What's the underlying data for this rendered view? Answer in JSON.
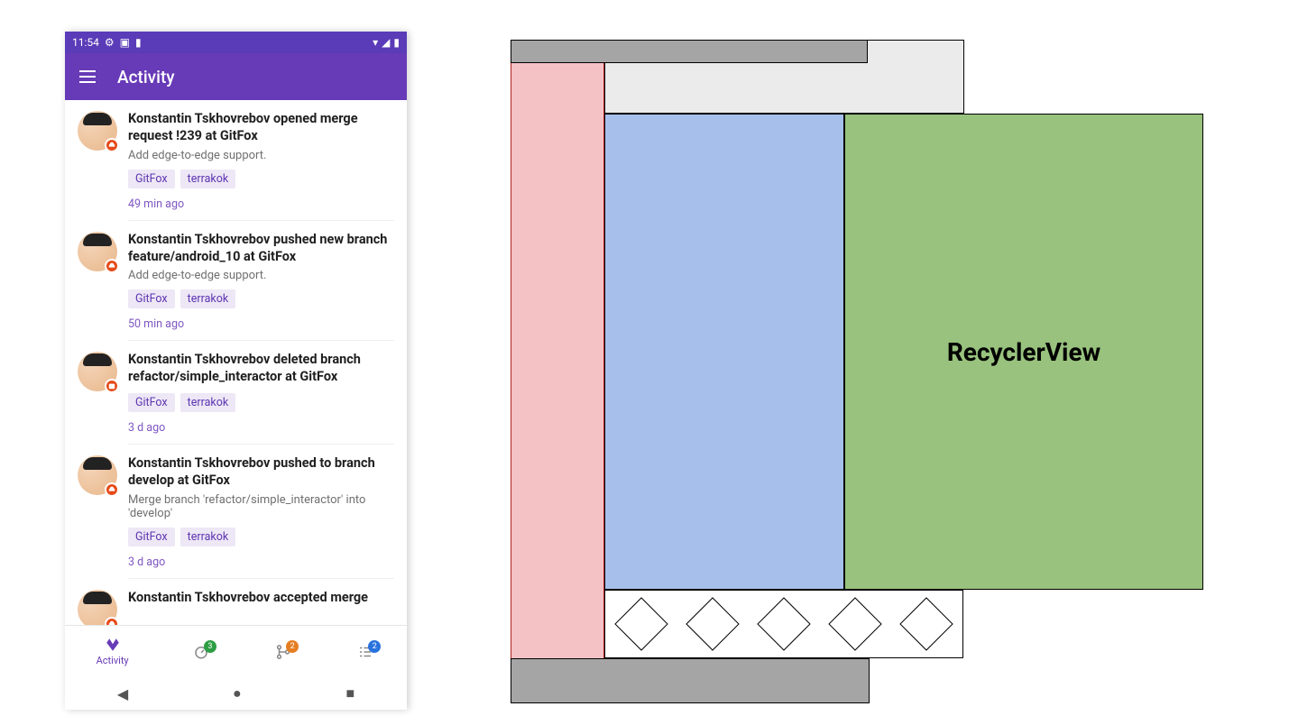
{
  "statusbar": {
    "time": "11:54",
    "icons_left": [
      "gear",
      "doc",
      "card"
    ],
    "icons_right": [
      "wifi",
      "signal",
      "battery"
    ]
  },
  "appbar": {
    "title": "Activity"
  },
  "feed": [
    {
      "title": "Konstantin Tskhovrebov opened merge request !239 at GitFox",
      "desc": "Add edge-to-edge support.",
      "chips": [
        "GitFox",
        "terrakok"
      ],
      "time": "49 min ago",
      "badge": "cloud"
    },
    {
      "title": "Konstantin Tskhovrebov pushed new branch feature/android_10 at GitFox",
      "desc": "Add edge-to-edge support.",
      "chips": [
        "GitFox",
        "terrakok"
      ],
      "time": "50 min ago",
      "badge": "cloud"
    },
    {
      "title": "Konstantin Tskhovrebov deleted branch refactor/simple_interactor at GitFox",
      "desc": "",
      "chips": [
        "GitFox",
        "terrakok"
      ],
      "time": "3 d ago",
      "badge": "delete"
    },
    {
      "title": "Konstantin Tskhovrebov pushed to branch develop at GitFox",
      "desc": "Merge branch 'refactor/simple_interactor' into 'develop'",
      "chips": [
        "GitFox",
        "terrakok"
      ],
      "time": "3 d ago",
      "badge": "cloud"
    },
    {
      "title": "Konstantin Tskhovrebov accepted merge",
      "desc": "",
      "chips": [],
      "time": "",
      "badge": "cloud"
    }
  ],
  "bottomnav": [
    {
      "label": "Activity",
      "icon": "gitlab",
      "active": true,
      "badge": null,
      "badge_color": null
    },
    {
      "label": "",
      "icon": "speed",
      "active": false,
      "badge": "3",
      "badge_color": "#2e9e44"
    },
    {
      "label": "",
      "icon": "merge",
      "active": false,
      "badge": "2",
      "badge_color": "#e67e22"
    },
    {
      "label": "",
      "icon": "todo",
      "active": false,
      "badge": "2",
      "badge_color": "#2872dd"
    }
  ],
  "diagram": {
    "recycler_label": "RecyclerView",
    "nav_placeholder_count": 5,
    "zones": [
      "statusbar-overhang",
      "sidebar-inset",
      "appbar",
      "content",
      "recyclerview",
      "bottomnav",
      "syskeys-overhang"
    ]
  }
}
